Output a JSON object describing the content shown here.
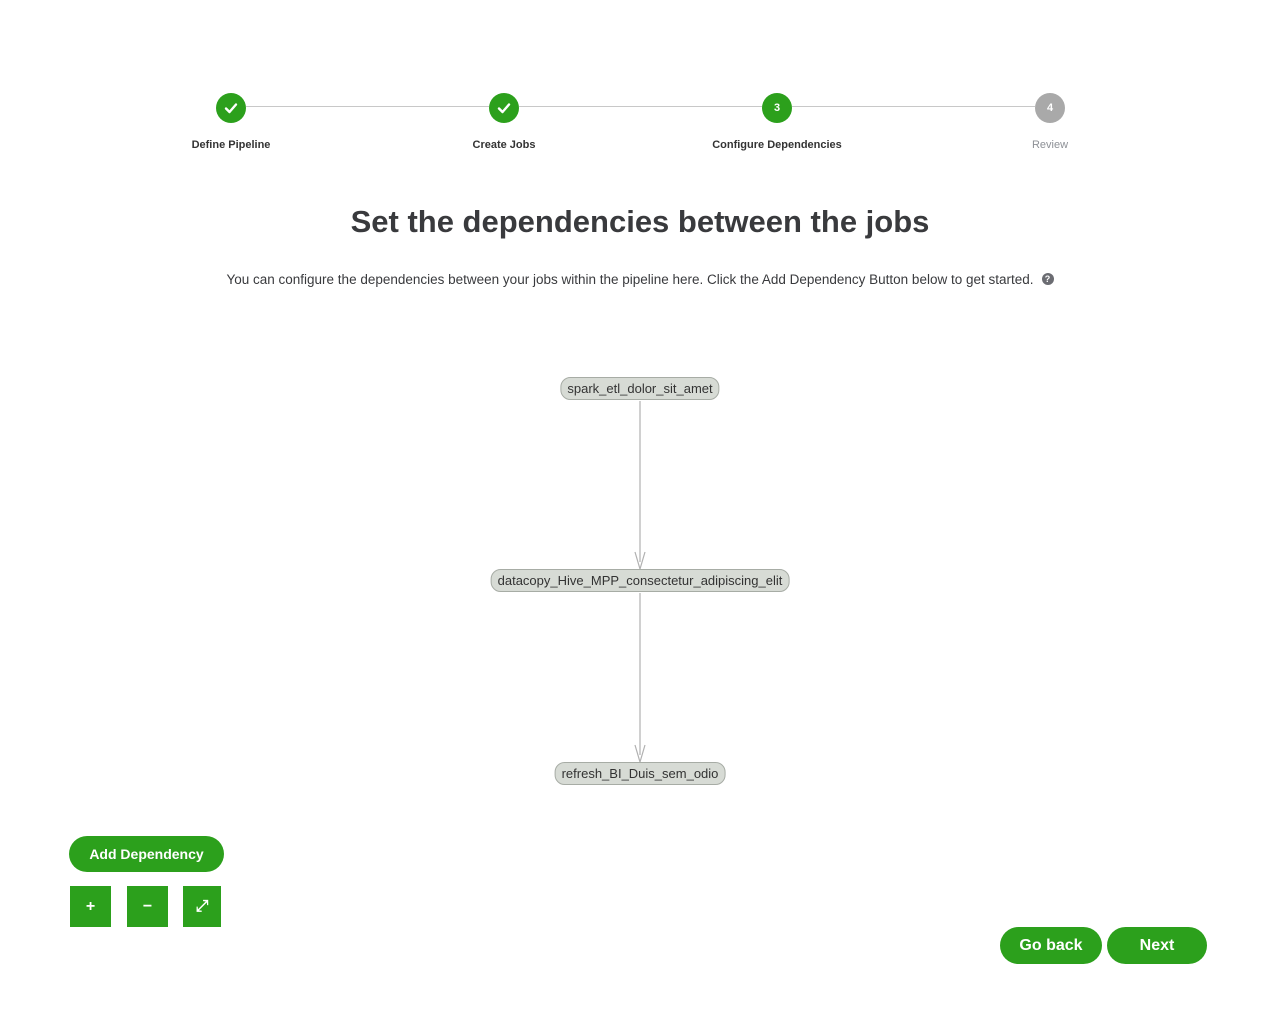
{
  "stepper": {
    "steps": [
      {
        "label": "Define Pipeline",
        "state": "done",
        "number": "1"
      },
      {
        "label": "Create Jobs",
        "state": "done",
        "number": "2"
      },
      {
        "label": "Configure Dependencies",
        "state": "current",
        "number": "3"
      },
      {
        "label": "Review",
        "state": "pending",
        "number": "4"
      }
    ]
  },
  "page": {
    "title": "Set the dependencies between the jobs",
    "subtitle": "You can configure the dependencies between your jobs within the pipeline here. Click the Add Dependency Button below to get started.",
    "help_icon": "question-circle-icon"
  },
  "graph": {
    "nodes": [
      {
        "label": "spark_etl_dolor_sit_amet"
      },
      {
        "label": "datacopy_Hive_MPP_consectetur_adipiscing_elit"
      },
      {
        "label": "refresh_BI_Duis_sem_odio"
      }
    ],
    "edges": [
      {
        "from": "spark_etl_dolor_sit_amet",
        "to": "datacopy_Hive_MPP_consectetur_adipiscing_elit"
      },
      {
        "from": "datacopy_Hive_MPP_consectetur_adipiscing_elit",
        "to": "refresh_BI_Duis_sem_odio"
      }
    ]
  },
  "controls": {
    "add_dependency_label": "Add Dependency",
    "zoom_in_label": "+",
    "zoom_out_label": "−",
    "fit_label": "⤢"
  },
  "footer": {
    "go_back_label": "Go back",
    "next_label": "Next"
  },
  "colors": {
    "accent": "#2ca01c",
    "pending": "#a9a9a9",
    "node_fill": "#d7dbd5",
    "edge": "#b0b0b0"
  }
}
